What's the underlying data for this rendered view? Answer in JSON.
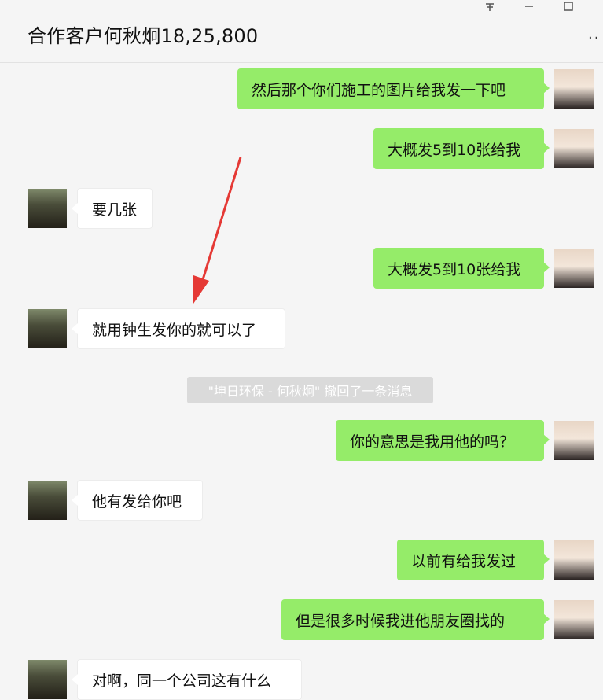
{
  "header": {
    "title": "合作客户何秋炯18,25,800",
    "pin_icon": "pin-icon",
    "minimize_icon": "minimize-icon",
    "maximize_icon": "maximize-icon",
    "more_icon": "more-icon"
  },
  "messages": [
    {
      "from": "self",
      "text": "然后那个你们施工的图片给我发一下吧"
    },
    {
      "from": "self",
      "text": "大概发5到10张给我"
    },
    {
      "from": "peer",
      "text": "要几张"
    },
    {
      "from": "self",
      "text": "大概发5到10张给我"
    },
    {
      "from": "peer",
      "text": "就用钟生发你的就可以了"
    },
    {
      "from": "self",
      "text": "你的意思是我用他的吗？"
    },
    {
      "from": "peer",
      "text": "他有发给你吧"
    },
    {
      "from": "self",
      "text": "以前有给我发过"
    },
    {
      "from": "self",
      "text": "但是很多时候我进他朋友圈找的"
    },
    {
      "from": "peer",
      "text": "对啊，同一个公司这有什么"
    }
  ],
  "system_notice": "\"坤日环保 - 何秋炯\" 撤回了一条消息",
  "colors": {
    "self_bubble": "#95ec69",
    "peer_bubble": "#ffffff",
    "annotation_arrow": "#e53935"
  }
}
